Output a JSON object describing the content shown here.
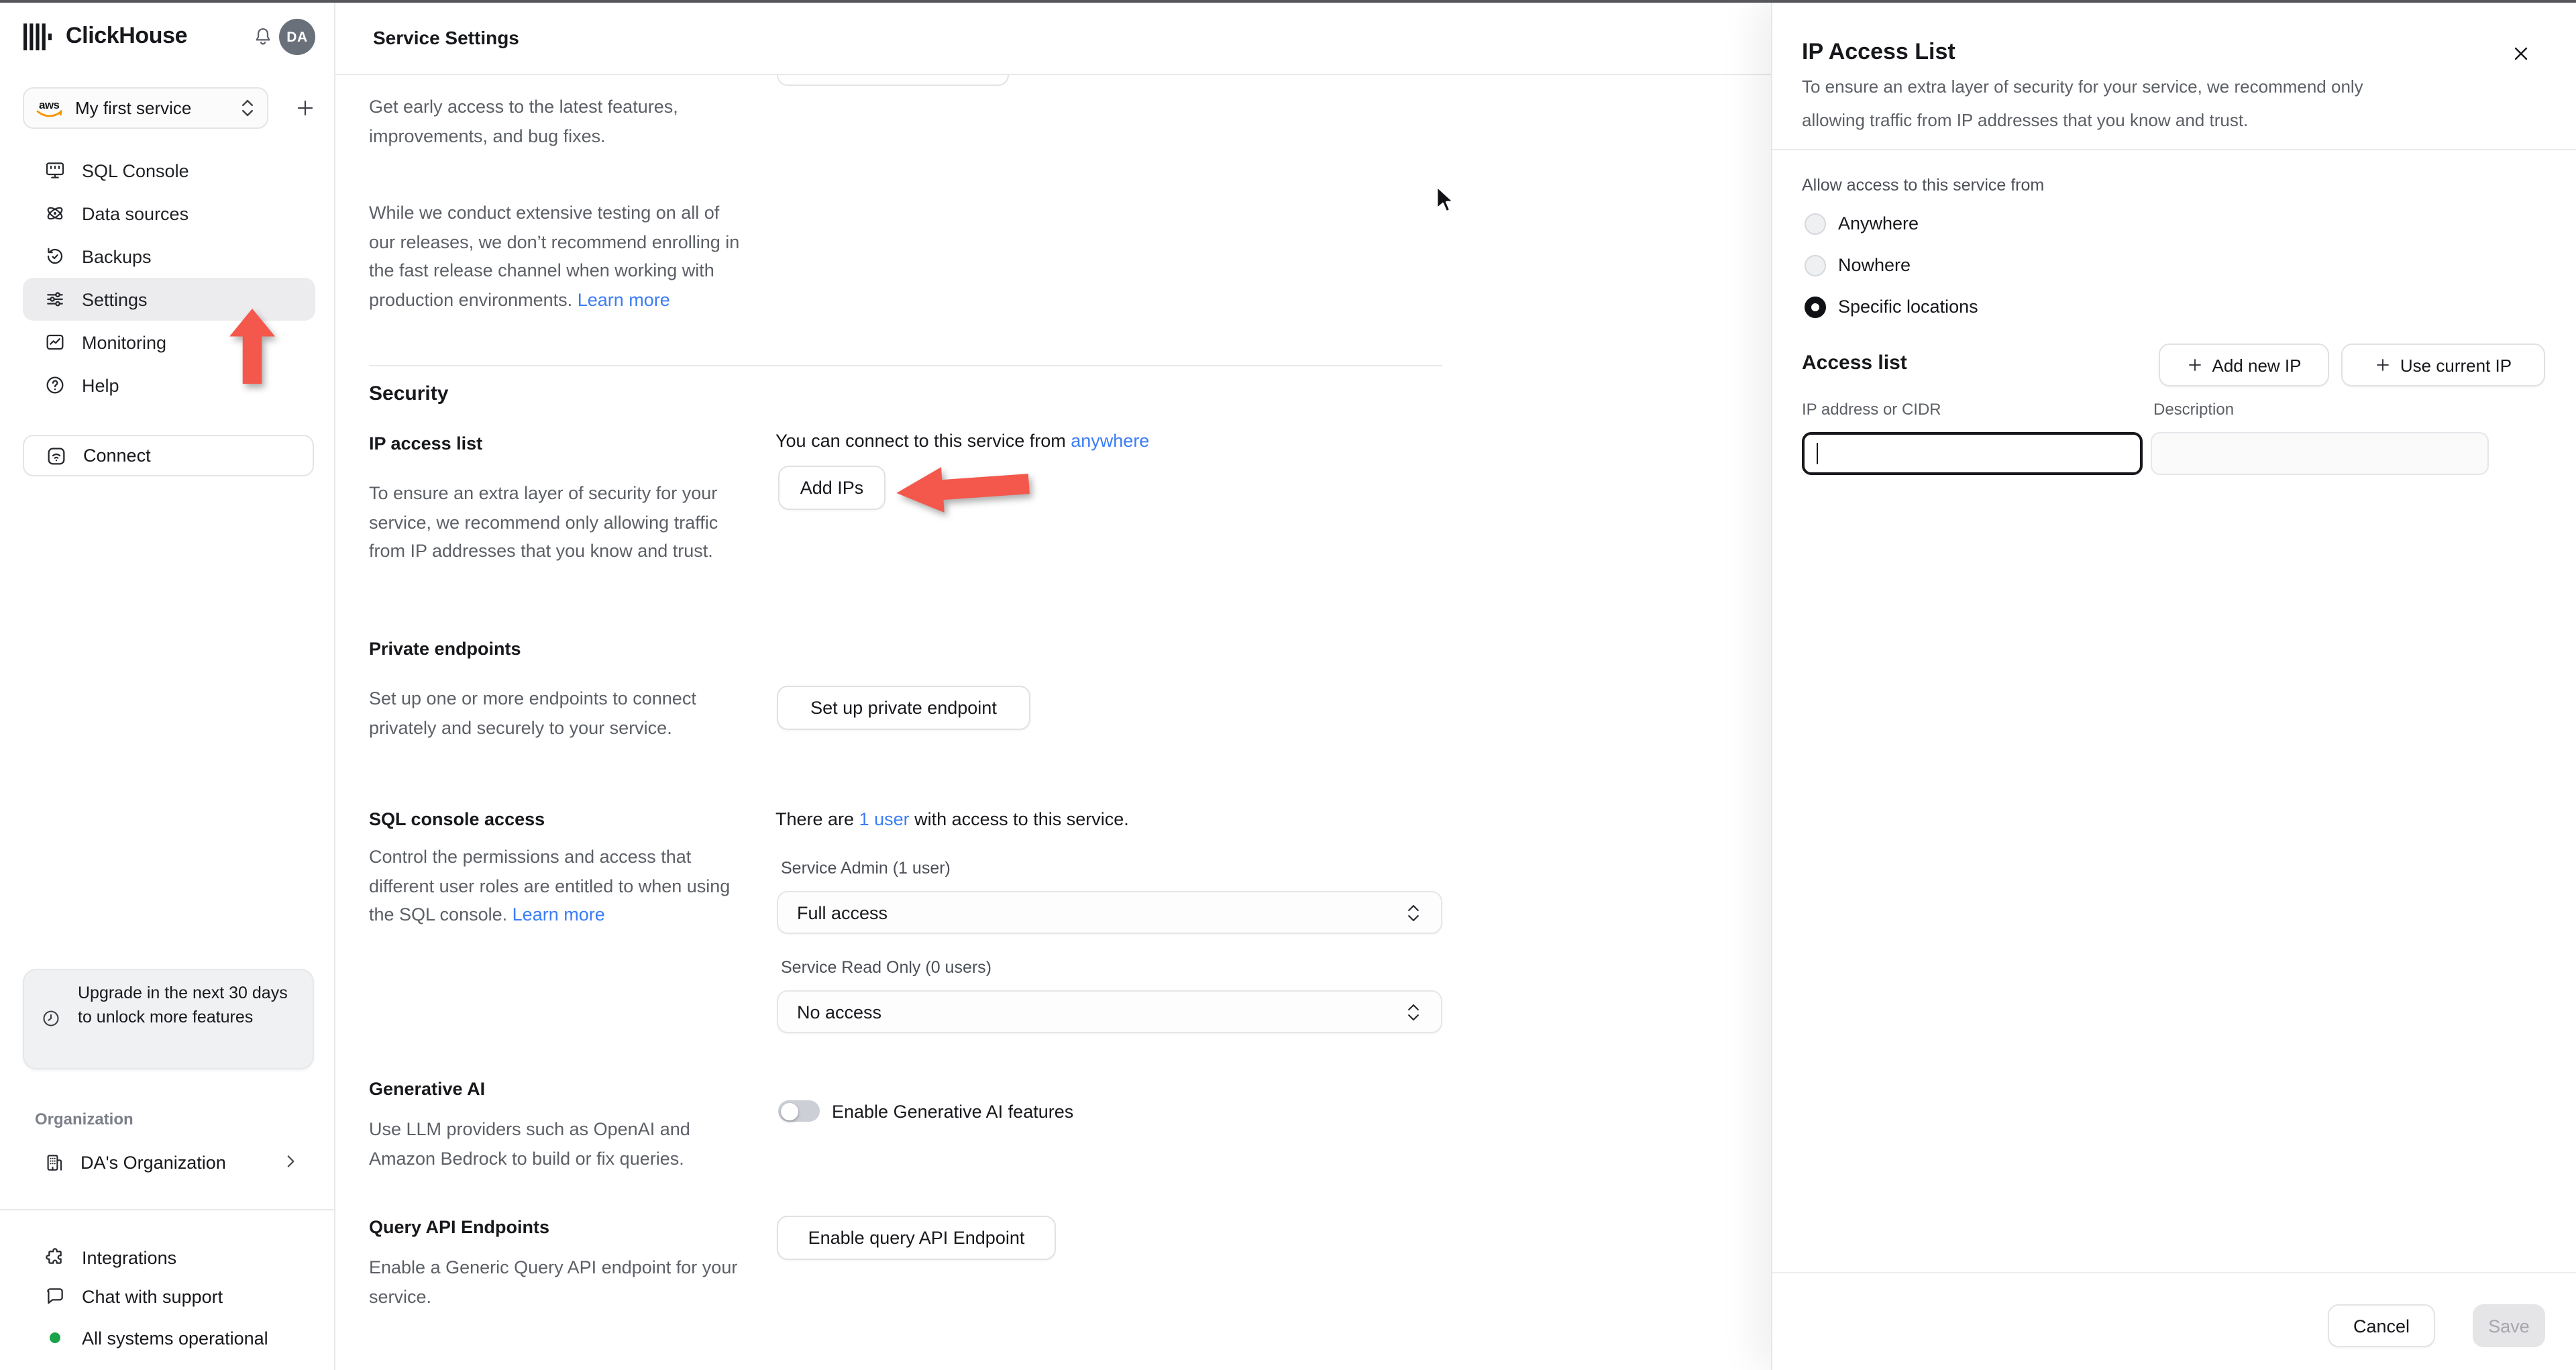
{
  "chrome": {
    "brand": "ClickHouse",
    "avatar_initials": "DA"
  },
  "sidebar": {
    "service_selector": {
      "provider": "aws",
      "label": "My first service"
    },
    "nav": [
      {
        "label": "SQL Console"
      },
      {
        "label": "Data sources"
      },
      {
        "label": "Backups"
      },
      {
        "label": "Settings"
      },
      {
        "label": "Monitoring"
      },
      {
        "label": "Help"
      }
    ],
    "connect_label": "Connect",
    "upgrade_notice": "Upgrade in the next 30 days to unlock more features",
    "organization_label": "Organization",
    "organization_name": "DA's Organization",
    "footer_items": [
      {
        "label": "Integrations"
      },
      {
        "label": "Chat with support"
      },
      {
        "label": "All systems operational"
      }
    ]
  },
  "main": {
    "title": "Service Settings",
    "intro": {
      "p1": "Get early access to the latest features, improvements, and bug fixes.",
      "p2": "While we conduct extensive testing on all of our releases, we don’t recommend enrolling in the fast release channel when working with production environments. ",
      "p2_link": "Learn more"
    },
    "security": {
      "heading": "Security",
      "ip_access": {
        "title": "IP access list",
        "description": "To ensure an extra layer of security for your service, we recommend only allowing traffic from IP addresses that you know and trust.",
        "status_text": "You can connect to this service from ",
        "status_link": "anywhere",
        "button": "Add IPs"
      },
      "private_endpoints": {
        "title": "Private endpoints",
        "description": "Set up one or more endpoints to connect privately and securely to your service.",
        "button": "Set up private endpoint"
      },
      "sql_console_access": {
        "title": "SQL console access",
        "description": "Control the permissions and access that different user roles are entitled to when using the SQL console. ",
        "description_link": "Learn more",
        "status_prefix": "There are ",
        "status_link": "1 user",
        "status_suffix": " with access to this service.",
        "admin_label": "Service Admin (1 user)",
        "admin_value": "Full access",
        "readonly_label": "Service Read Only (0 users)",
        "readonly_value": "No access"
      },
      "generative_ai": {
        "title": "Generative AI",
        "description": "Use LLM providers such as OpenAI and Amazon Bedrock to build or fix queries.",
        "toggle_label": "Enable Generative AI features",
        "toggle_on": false
      },
      "query_api": {
        "title": "Query API Endpoints",
        "description": "Enable a Generic Query API endpoint for your service.",
        "button": "Enable query API Endpoint"
      }
    }
  },
  "panel": {
    "title": "IP Access List",
    "subtitle": "To ensure an extra layer of security for your service, we recommend only allowing traffic from IP addresses that you know and trust.",
    "allow_label": "Allow access to this service from",
    "options": [
      {
        "label": "Anywhere",
        "selected": false
      },
      {
        "label": "Nowhere",
        "selected": false
      },
      {
        "label": "Specific locations",
        "selected": true
      }
    ],
    "access_list": {
      "heading": "Access list",
      "add_new_ip": "Add new IP",
      "use_current_ip": "Use current IP",
      "ip_label": "IP address or CIDR",
      "desc_label": "Description",
      "ip_value": "",
      "desc_value": ""
    },
    "footer": {
      "cancel": "Cancel",
      "save": "Save"
    }
  },
  "colors": {
    "accent_blue": "#3b7cf7",
    "arrow_red": "#f4574b",
    "status_green": "#1aa34a",
    "focus_border": "#17181c"
  }
}
